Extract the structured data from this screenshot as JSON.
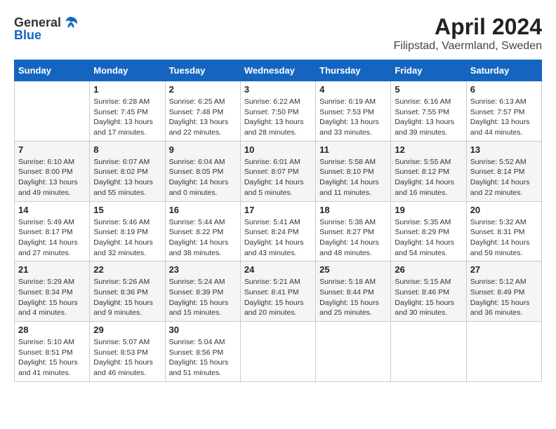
{
  "header": {
    "logo_general": "General",
    "logo_blue": "Blue",
    "title": "April 2024",
    "subtitle": "Filipstad, Vaermland, Sweden"
  },
  "calendar": {
    "days_of_week": [
      "Sunday",
      "Monday",
      "Tuesday",
      "Wednesday",
      "Thursday",
      "Friday",
      "Saturday"
    ],
    "weeks": [
      [
        {
          "day": "",
          "info": ""
        },
        {
          "day": "1",
          "info": "Sunrise: 6:28 AM\nSunset: 7:45 PM\nDaylight: 13 hours\nand 17 minutes."
        },
        {
          "day": "2",
          "info": "Sunrise: 6:25 AM\nSunset: 7:48 PM\nDaylight: 13 hours\nand 22 minutes."
        },
        {
          "day": "3",
          "info": "Sunrise: 6:22 AM\nSunset: 7:50 PM\nDaylight: 13 hours\nand 28 minutes."
        },
        {
          "day": "4",
          "info": "Sunrise: 6:19 AM\nSunset: 7:53 PM\nDaylight: 13 hours\nand 33 minutes."
        },
        {
          "day": "5",
          "info": "Sunrise: 6:16 AM\nSunset: 7:55 PM\nDaylight: 13 hours\nand 39 minutes."
        },
        {
          "day": "6",
          "info": "Sunrise: 6:13 AM\nSunset: 7:57 PM\nDaylight: 13 hours\nand 44 minutes."
        }
      ],
      [
        {
          "day": "7",
          "info": "Sunrise: 6:10 AM\nSunset: 8:00 PM\nDaylight: 13 hours\nand 49 minutes."
        },
        {
          "day": "8",
          "info": "Sunrise: 6:07 AM\nSunset: 8:02 PM\nDaylight: 13 hours\nand 55 minutes."
        },
        {
          "day": "9",
          "info": "Sunrise: 6:04 AM\nSunset: 8:05 PM\nDaylight: 14 hours\nand 0 minutes."
        },
        {
          "day": "10",
          "info": "Sunrise: 6:01 AM\nSunset: 8:07 PM\nDaylight: 14 hours\nand 5 minutes."
        },
        {
          "day": "11",
          "info": "Sunrise: 5:58 AM\nSunset: 8:10 PM\nDaylight: 14 hours\nand 11 minutes."
        },
        {
          "day": "12",
          "info": "Sunrise: 5:55 AM\nSunset: 8:12 PM\nDaylight: 14 hours\nand 16 minutes."
        },
        {
          "day": "13",
          "info": "Sunrise: 5:52 AM\nSunset: 8:14 PM\nDaylight: 14 hours\nand 22 minutes."
        }
      ],
      [
        {
          "day": "14",
          "info": "Sunrise: 5:49 AM\nSunset: 8:17 PM\nDaylight: 14 hours\nand 27 minutes."
        },
        {
          "day": "15",
          "info": "Sunrise: 5:46 AM\nSunset: 8:19 PM\nDaylight: 14 hours\nand 32 minutes."
        },
        {
          "day": "16",
          "info": "Sunrise: 5:44 AM\nSunset: 8:22 PM\nDaylight: 14 hours\nand 38 minutes."
        },
        {
          "day": "17",
          "info": "Sunrise: 5:41 AM\nSunset: 8:24 PM\nDaylight: 14 hours\nand 43 minutes."
        },
        {
          "day": "18",
          "info": "Sunrise: 5:38 AM\nSunset: 8:27 PM\nDaylight: 14 hours\nand 48 minutes."
        },
        {
          "day": "19",
          "info": "Sunrise: 5:35 AM\nSunset: 8:29 PM\nDaylight: 14 hours\nand 54 minutes."
        },
        {
          "day": "20",
          "info": "Sunrise: 5:32 AM\nSunset: 8:31 PM\nDaylight: 14 hours\nand 59 minutes."
        }
      ],
      [
        {
          "day": "21",
          "info": "Sunrise: 5:29 AM\nSunset: 8:34 PM\nDaylight: 15 hours\nand 4 minutes."
        },
        {
          "day": "22",
          "info": "Sunrise: 5:26 AM\nSunset: 8:36 PM\nDaylight: 15 hours\nand 9 minutes."
        },
        {
          "day": "23",
          "info": "Sunrise: 5:24 AM\nSunset: 8:39 PM\nDaylight: 15 hours\nand 15 minutes."
        },
        {
          "day": "24",
          "info": "Sunrise: 5:21 AM\nSunset: 8:41 PM\nDaylight: 15 hours\nand 20 minutes."
        },
        {
          "day": "25",
          "info": "Sunrise: 5:18 AM\nSunset: 8:44 PM\nDaylight: 15 hours\nand 25 minutes."
        },
        {
          "day": "26",
          "info": "Sunrise: 5:15 AM\nSunset: 8:46 PM\nDaylight: 15 hours\nand 30 minutes."
        },
        {
          "day": "27",
          "info": "Sunrise: 5:12 AM\nSunset: 8:49 PM\nDaylight: 15 hours\nand 36 minutes."
        }
      ],
      [
        {
          "day": "28",
          "info": "Sunrise: 5:10 AM\nSunset: 8:51 PM\nDaylight: 15 hours\nand 41 minutes."
        },
        {
          "day": "29",
          "info": "Sunrise: 5:07 AM\nSunset: 8:53 PM\nDaylight: 15 hours\nand 46 minutes."
        },
        {
          "day": "30",
          "info": "Sunrise: 5:04 AM\nSunset: 8:56 PM\nDaylight: 15 hours\nand 51 minutes."
        },
        {
          "day": "",
          "info": ""
        },
        {
          "day": "",
          "info": ""
        },
        {
          "day": "",
          "info": ""
        },
        {
          "day": "",
          "info": ""
        }
      ]
    ]
  }
}
